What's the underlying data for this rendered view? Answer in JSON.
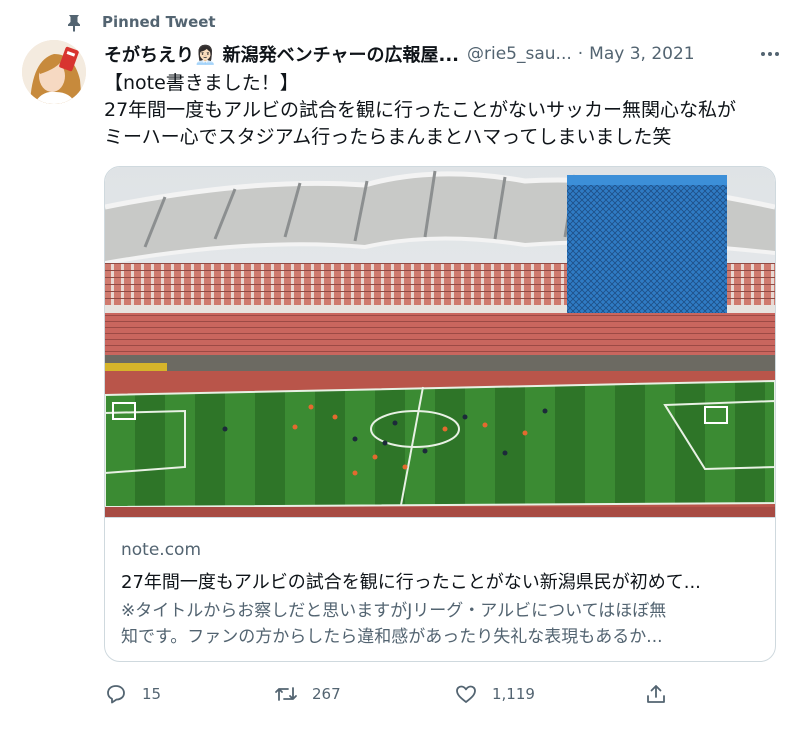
{
  "pinned": {
    "label": "Pinned Tweet"
  },
  "author": {
    "display_name": "そがちえり👩🏻‍💼 新潟発ベンチャーの広報屋...",
    "handle": "@rie5_sau...",
    "separator": "·",
    "date": "May 3, 2021"
  },
  "tweet": {
    "lines": [
      "【note書きました！】",
      "27年間一度もアルビの試合を観に行ったことがないサッカー無関心な私が",
      "ミーハー心でスタジアム行ったらまんまとハマってしまいました笑"
    ]
  },
  "card": {
    "domain": "note.com",
    "title": "27年間一度もアルビの試合を観に行ったことがない新潟県民が初めて...",
    "description_lines": [
      "※タイトルからお察しだと思いますがJリーグ・アルビについてはほぼ無",
      "知です。ファンの方からしたら違和感があったり失礼な表現もあるか..."
    ]
  },
  "actions": {
    "reply_count": "15",
    "retweet_count": "267",
    "like_count": "1,119"
  },
  "colors": {
    "text": "#0f1419",
    "secondary": "#536471",
    "border": "#cfd9de",
    "pitch_green": "#2f7d2c",
    "seats_red": "#c9665e",
    "scaffold_blue": "#2f7bc4"
  },
  "icons": [
    "pin-icon",
    "more-icon",
    "reply-icon",
    "retweet-icon",
    "like-icon",
    "share-icon"
  ]
}
